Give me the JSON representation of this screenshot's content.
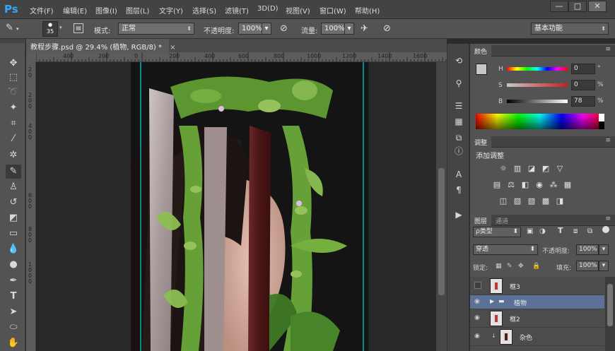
{
  "app": {
    "logo": "Ps"
  },
  "menu": [
    "文件(F)",
    "编辑(E)",
    "图像(I)",
    "图层(L)",
    "文字(Y)",
    "选择(S)",
    "滤镜(T)",
    "3D(D)",
    "视图(V)",
    "窗口(W)",
    "帮助(H)"
  ],
  "window_controls": {
    "minimize": "—",
    "restore": "□",
    "close": "✕"
  },
  "options": {
    "brush_size": "35",
    "mode_label": "模式:",
    "mode_value": "正常",
    "opacity_label": "不透明度:",
    "opacity_value": "100%",
    "flow_label": "流量:",
    "flow_value": "100%",
    "workspace": "基本功能"
  },
  "document": {
    "tab_title": "教程步骤.psd @ 29.4% (植物, RGB/8) *",
    "tab_close": "×"
  },
  "ruler_h": [
    "400",
    "200",
    "0",
    "200",
    "400",
    "600",
    "800",
    "1000",
    "1200",
    "1400",
    "1600"
  ],
  "ruler_v": [
    "2",
    "0",
    "2",
    "0",
    "0",
    "4",
    "0",
    "0",
    "6",
    "0",
    "0",
    "8",
    "0",
    "0",
    "1",
    "0",
    "0",
    "0"
  ],
  "panels": {
    "color": {
      "tab": "颜色",
      "h_label": "H",
      "h_value": "0",
      "h_unit": "°",
      "s_label": "S",
      "s_value": "0",
      "s_unit": "%",
      "b_label": "B",
      "b_value": "78",
      "b_unit": "%"
    },
    "adjustments": {
      "tab": "调整",
      "add_label": "添加调整"
    },
    "layers": {
      "tab_layers": "图层",
      "tab_channels": "通道",
      "filter_kind": "ρ类型",
      "blend_mode": "穿透",
      "opacity_label": "不透明度:",
      "opacity_value": "100%",
      "lock_label": "锁定:",
      "fill_label": "填充:",
      "fill_value": "100%",
      "items": [
        {
          "name": "框3"
        },
        {
          "name": "植物"
        },
        {
          "name": "框2"
        },
        {
          "name": "杂色"
        }
      ]
    }
  },
  "colors": {
    "accent": "#31a8ff",
    "selected_layer": "#5b7296",
    "guide": "#00ffff"
  }
}
